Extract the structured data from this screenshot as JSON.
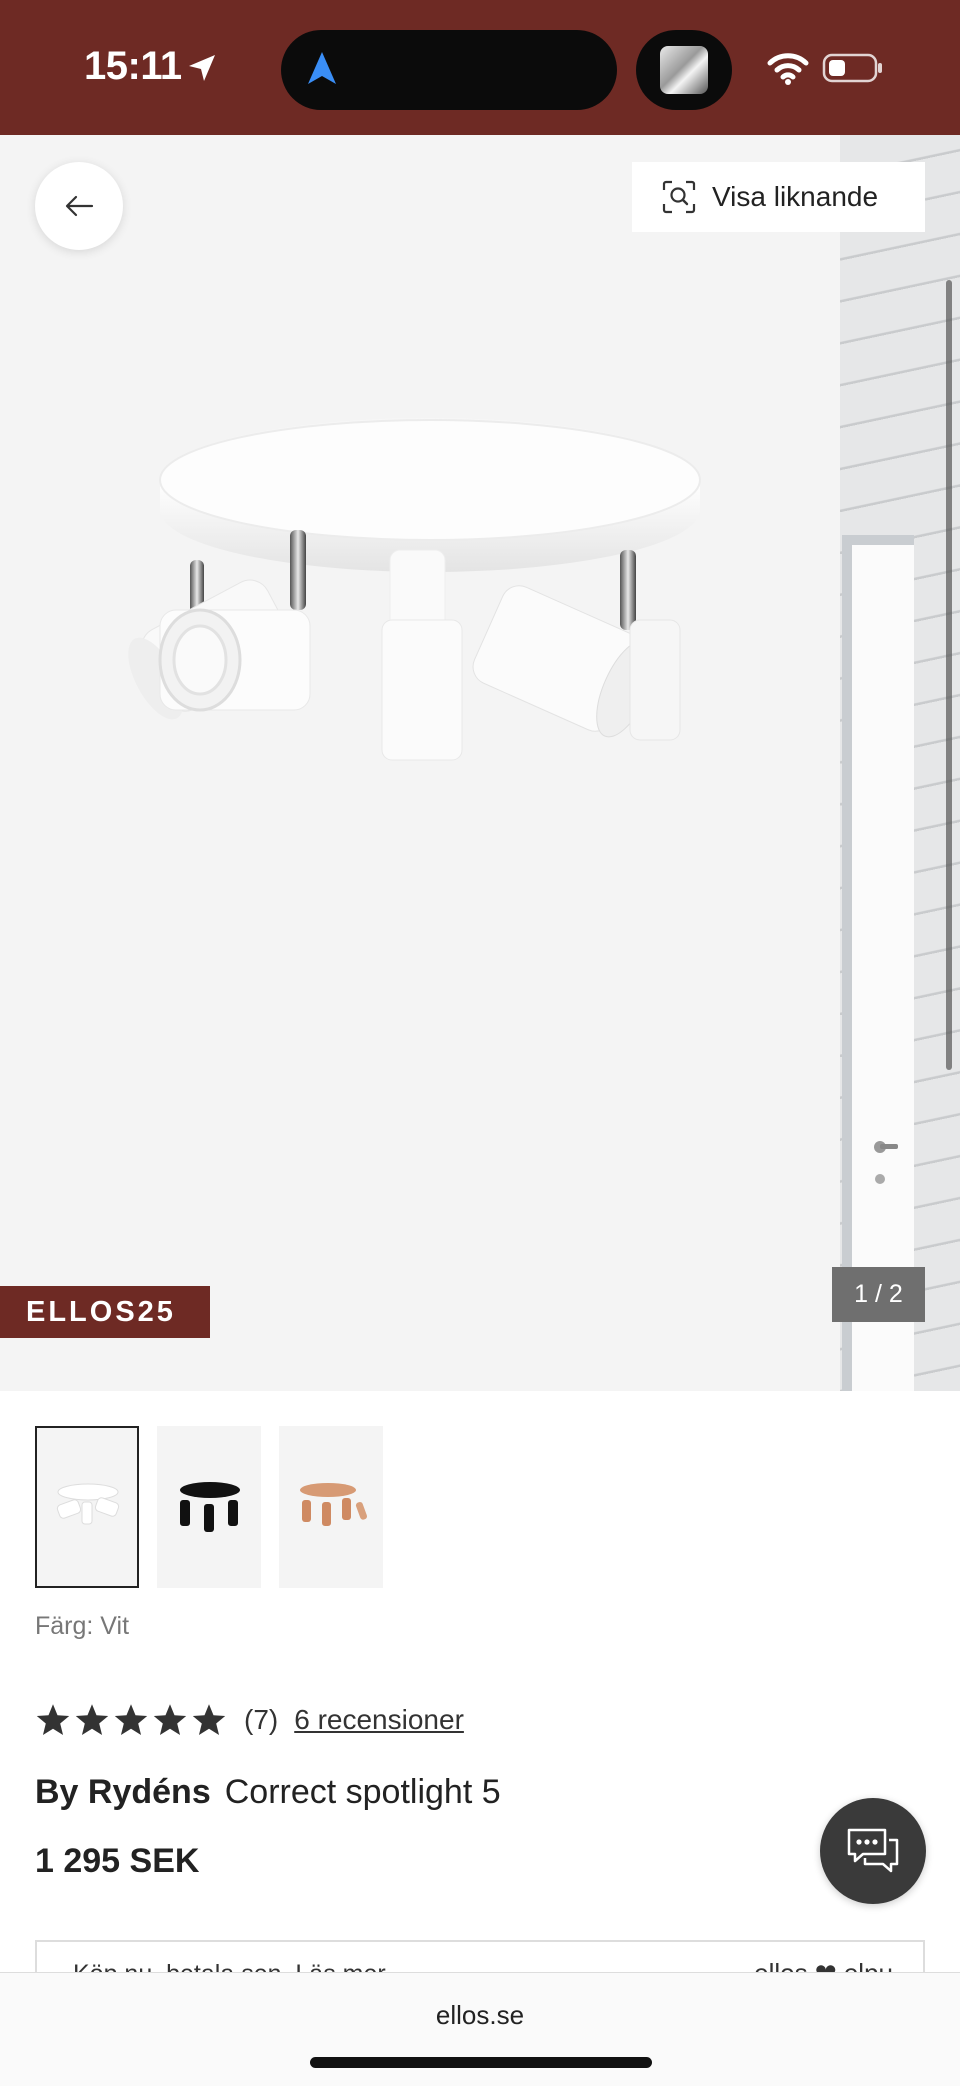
{
  "status": {
    "time": "15:11"
  },
  "header": {
    "similar_label": "Visa liknande"
  },
  "gallery": {
    "promo_code": "ELLOS25",
    "page_indicator": "1 / 2",
    "thumbnails": [
      {
        "variant": "white",
        "selected": true
      },
      {
        "variant": "black",
        "selected": false
      },
      {
        "variant": "copper",
        "selected": false
      }
    ]
  },
  "product": {
    "color_label": "Färg: Vit",
    "rating_stars": 5,
    "rating_count": "(7)",
    "reviews_link": "6 recensioner",
    "brand": "By Rydéns",
    "name": "Correct spotlight 5",
    "price": "1 295 SEK"
  },
  "payment": {
    "text": "Köp nu, betala sen. Läs mer",
    "brand": "ellos ❤ elpu"
  },
  "browser": {
    "url": "ellos.se"
  },
  "colors": {
    "brand_maroon": "#6e2a24",
    "image_background": "#f4f4f4",
    "text_dark": "#222222",
    "chat_button": "#3a3a3a"
  },
  "icons": {
    "back": "arrow-left-icon",
    "similar": "visual-search-icon",
    "chat": "chat-bubble-icon",
    "star": "star-icon"
  }
}
